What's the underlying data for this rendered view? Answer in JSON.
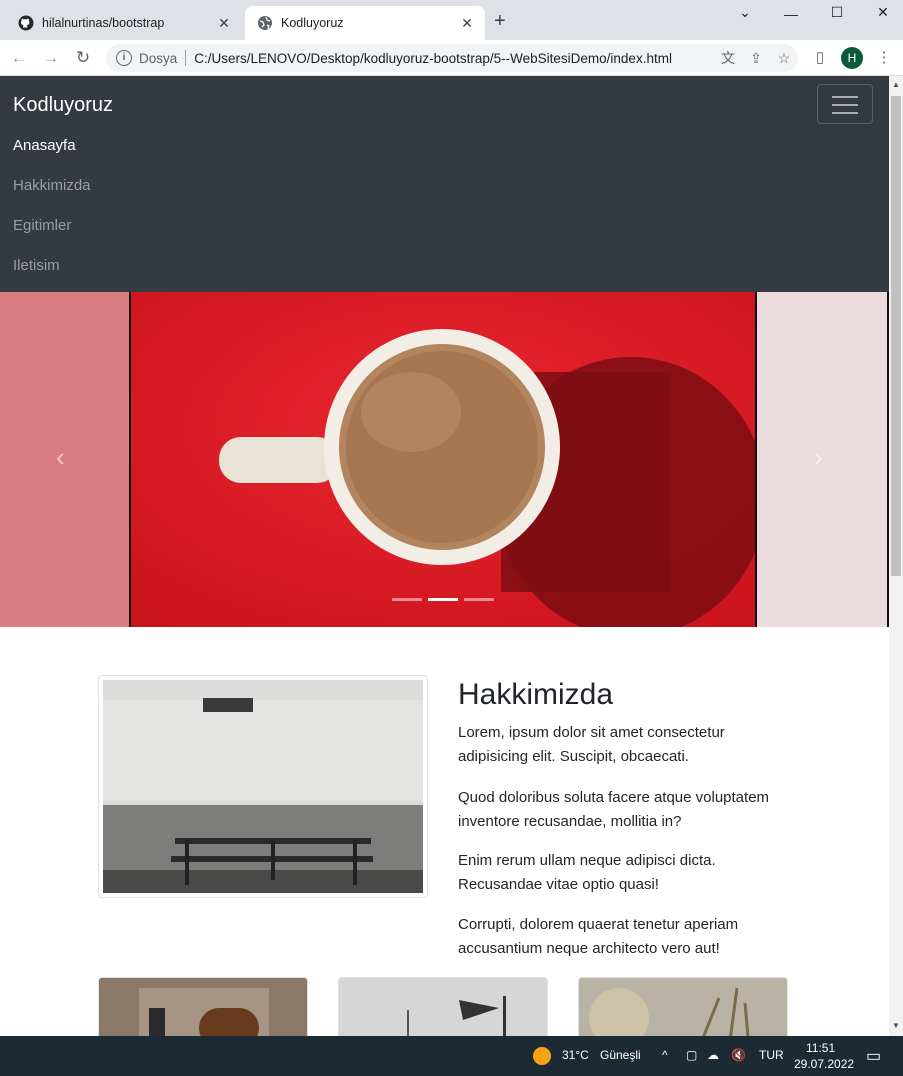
{
  "browser": {
    "tabs": [
      {
        "title": "hilalnurtinas/bootstrap",
        "icon": "github-icon"
      },
      {
        "title": "Kodluyoruz",
        "icon": "globe-icon"
      }
    ],
    "omnibox": {
      "scheme_label": "Dosya",
      "url": "C:/Users/LENOVO/Desktop/kodluyoruz-bootstrap/5--WebSitesiDemo/index.html"
    },
    "profile_initial": "H"
  },
  "site": {
    "brand": "Kodluyoruz",
    "nav": [
      "Anasayfa",
      "Hakkimizda",
      "Egitimler",
      "Iletisim"
    ],
    "carousel": {
      "prev_label": "‹",
      "next_label": "›",
      "active_indicator": 2,
      "indicator_count": 3
    },
    "about": {
      "title": "Hakkimizda",
      "paragraphs": [
        "Lorem, ipsum dolor sit amet consectetur adipisicing elit. Suscipit, obcaecati.",
        "Quod doloribus soluta facere atque voluptatem inventore recusandae, mollitia in?",
        "Enim rerum ullam neque adipisci dicta. Recusandae vitae optio quasi!",
        "Corrupti, dolorem quaerat tenetur aperiam accusantium neque architecto vero aut!"
      ]
    }
  },
  "taskbar": {
    "temperature": "31°C",
    "weather": "Güneşli",
    "language": "TUR",
    "time": "11:51",
    "date": "29.07.2022"
  }
}
